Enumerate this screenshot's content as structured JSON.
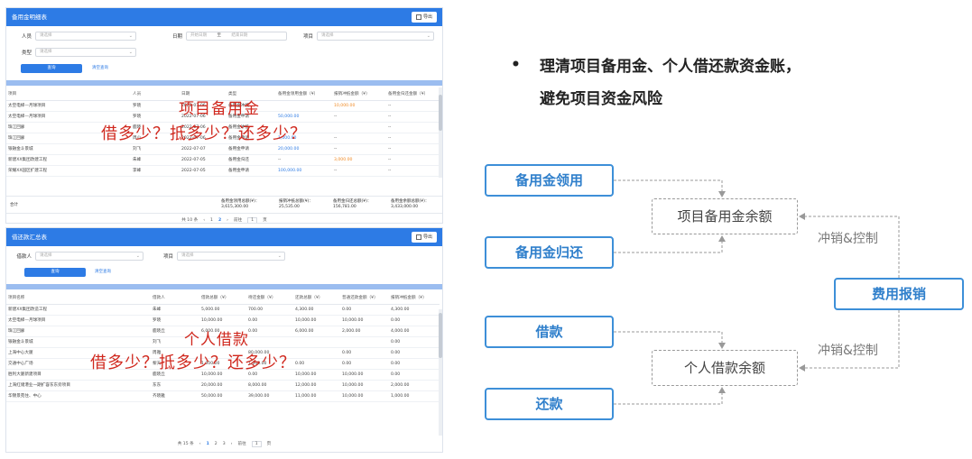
{
  "panel1": {
    "title": "备用金明细表",
    "export_label": "导出",
    "filters": {
      "person_label": "人员",
      "person_placeholder": "请选择",
      "date_label": "日期",
      "date_start_placeholder": "开始日期",
      "date_sep": "至",
      "date_end_placeholder": "结束日期",
      "project_label": "项目",
      "project_placeholder": "请选择",
      "type_label": "类型",
      "type_placeholder": "请选择"
    },
    "query_label": "查询",
    "clear_label": "清空查询",
    "columns": [
      "项目",
      "人员",
      "日期",
      "类型",
      "备用金领用金额（¥）",
      "报销冲抵金额（¥）",
      "备用金归还金额（¥）"
    ],
    "rows": [
      [
        "太空电梯—月球项目",
        "罗晓",
        "2022-07-06",
        "备用金冲抵",
        "",
        "10,000.00",
        "--"
      ],
      [
        "太空电梯—月球项目",
        "罗晓",
        "2022-07-06",
        "备用金申请",
        "50,000.00",
        "--",
        "--"
      ],
      [
        "珠江回廊",
        "鹿晓",
        "2022-07-06",
        "备用金冲抵",
        "",
        "",
        "--"
      ],
      [
        "珠江回廊",
        "周小",
        "2022-07-06",
        "备用金申请",
        "1,000.00",
        "--",
        "--"
      ],
      [
        "银融金斗景城",
        "刘飞",
        "2022-07-07",
        "备用金申请",
        "20,000.00",
        "--",
        "--"
      ],
      [
        "新建XX集团改建工程",
        "朱峰",
        "2022-07-05",
        "备用金归还",
        "--",
        "3,000.00",
        "--"
      ],
      [
        "荣耀XX园区扩建工程",
        "李峰",
        "2022-07-05",
        "备用金申请",
        "100,000.00",
        "--",
        "--"
      ]
    ],
    "summary": {
      "label": "合计",
      "c1_title": "备用金领用总额(¥)：",
      "c1_value": "3,615,300.00",
      "c2_title": "报销冲抵总额(¥)：",
      "c2_value": "25,535.00",
      "c3_title": "备用金归还总额(¥)：",
      "c3_value": "156,781.00",
      "c4_title": "备用金余额总额(¥)：",
      "c4_value": "3,433,000.00"
    },
    "pager": {
      "total": "共 10 条",
      "prev": "‹",
      "p1": "1",
      "p2": "2",
      "next": "›",
      "goto": "前往",
      "goto_val": "1",
      "page_unit": "页"
    },
    "overlay_line1": "项目备用金",
    "overlay_line2": "借多少？抵多少？还多少？"
  },
  "panel2": {
    "title": "借还款汇总表",
    "export_label": "导出",
    "filters": {
      "borrower_label": "借款人",
      "borrower_placeholder": "请选择",
      "project_label": "项目",
      "project_placeholder": "请选择"
    },
    "query_label": "查询",
    "clear_label": "清空查询",
    "columns": [
      "项目名称",
      "借款人",
      "借款总额（¥）",
      "待还金额（¥）",
      "还款总额（¥）",
      "普通还款金额（¥）",
      "报销冲抵金额（¥）"
    ],
    "rows": [
      [
        "新建XX集团改造工程",
        "朱峰",
        "5,000.00",
        "700.00",
        "4,300.00",
        "0.00",
        "4,300.00"
      ],
      [
        "太空电梯—月球项目",
        "罗晓",
        "10,000.00",
        "0.00",
        "10,000.00",
        "10,000.00",
        "0.00"
      ],
      [
        "珠江回廊",
        "鹿晓丘",
        "6,000.00",
        "0.00",
        "6,000.00",
        "2,000.00",
        "4,000.00"
      ],
      [
        "银融金斗景城",
        "刘飞",
        "",
        "",
        "",
        "",
        "0.00"
      ],
      [
        "上海中心大厦",
        "周雅",
        "",
        "80,000.00",
        "",
        "0.00",
        "0.00"
      ],
      [
        "交通中心广场",
        "黎天",
        "1,000.00",
        "1,000.00",
        "0.00",
        "0.00",
        "0.00"
      ],
      [
        "胜利大厦新建项目",
        "鹿晓丘",
        "10,000.00",
        "0.00",
        "10,000.00",
        "10,000.00",
        "0.00"
      ],
      [
        "上海红储港业一期扩容东东旁项目",
        "东东",
        "20,000.00",
        "8,000.00",
        "12,000.00",
        "10,000.00",
        "2,000.00"
      ],
      [
        "华锦景苑住、中心",
        "齐晓雅",
        "50,000.00",
        "39,000.00",
        "11,000.00",
        "10,000.00",
        "1,000.00"
      ]
    ],
    "pager": {
      "total": "共 15 条",
      "prev": "‹",
      "p1": "1",
      "p2": "2",
      "p3": "3",
      "next": "›",
      "goto": "前往",
      "goto_val": "1",
      "page_unit": "页"
    },
    "overlay_line1": "个人借款",
    "overlay_line2": "借多少？抵多少？还多少？"
  },
  "bullet": {
    "dot": "•",
    "line1": "理清项目备用金、个人借还款资金账，",
    "line2": "避免项目资金风险"
  },
  "flow": {
    "box_reserve_use": "备用金领用",
    "box_reserve_return": "备用金归还",
    "box_loan": "借款",
    "box_repay": "还款",
    "box_reserve_balance": "项目备用金余额",
    "box_loan_balance": "个人借款余额",
    "box_expense": "费用报销",
    "label_offset1": "冲销&控制",
    "label_offset2": "冲销&控制"
  },
  "colors": {
    "header_blue": "#2d7be5",
    "flow_blue": "#3d8fd8",
    "overlay_red": "#d0281e"
  }
}
